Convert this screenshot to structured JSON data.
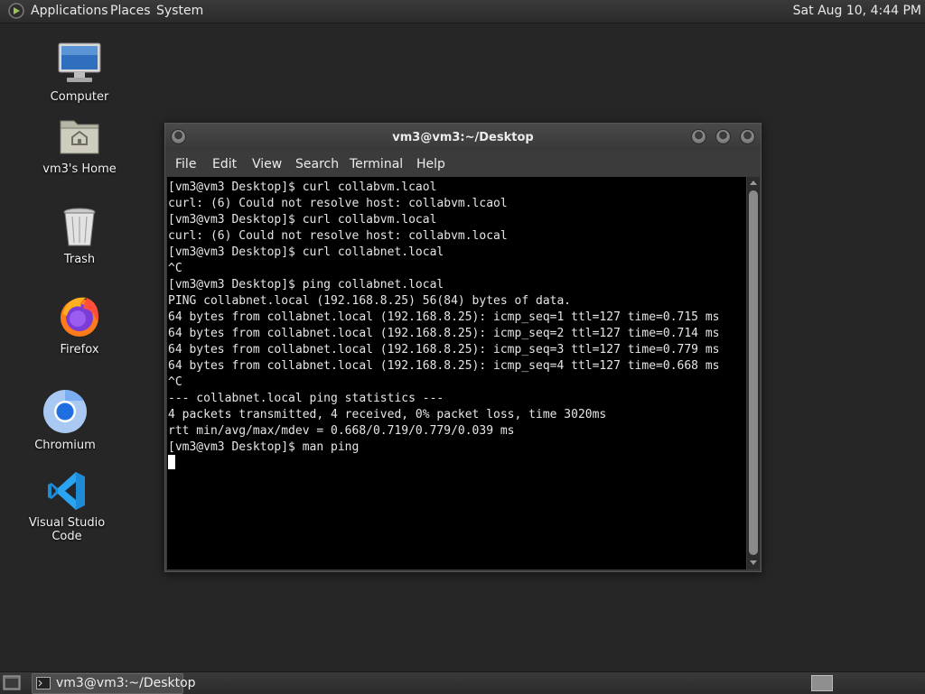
{
  "top_panel": {
    "menus": [
      "Applications",
      "Places",
      "System"
    ],
    "clock": "Sat Aug 10,  4:44 PM"
  },
  "desktop_icons": [
    {
      "label": "Computer",
      "icon": "computer-icon"
    },
    {
      "label": "vm3's Home",
      "icon": "home-folder-icon"
    },
    {
      "label": "Trash",
      "icon": "trash-icon"
    },
    {
      "label": "Firefox",
      "icon": "firefox-icon"
    },
    {
      "label": "Chromium",
      "icon": "chromium-icon"
    },
    {
      "label": "Visual Studio Code",
      "icon": "vscode-icon"
    }
  ],
  "terminal": {
    "title": "vm3@vm3:~/Desktop",
    "menu": [
      "File",
      "Edit",
      "View",
      "Search",
      "Terminal",
      "Help"
    ],
    "lines": [
      "[vm3@vm3 Desktop]$ curl collabvm.lcaol",
      "curl: (6) Could not resolve host: collabvm.lcaol",
      "[vm3@vm3 Desktop]$ curl collabvm.local",
      "curl: (6) Could not resolve host: collabvm.local",
      "[vm3@vm3 Desktop]$ curl collabnet.local",
      "^C",
      "[vm3@vm3 Desktop]$ ping collabnet.local",
      "PING collabnet.local (192.168.8.25) 56(84) bytes of data.",
      "64 bytes from collabnet.local (192.168.8.25): icmp_seq=1 ttl=127 time=0.715 ms",
      "64 bytes from collabnet.local (192.168.8.25): icmp_seq=2 ttl=127 time=0.714 ms",
      "64 bytes from collabnet.local (192.168.8.25): icmp_seq=3 ttl=127 time=0.779 ms",
      "64 bytes from collabnet.local (192.168.8.25): icmp_seq=4 ttl=127 time=0.668 ms",
      "^C",
      "--- collabnet.local ping statistics ---",
      "4 packets transmitted, 4 received, 0% packet loss, time 3020ms",
      "rtt min/avg/max/mdev = 0.668/0.719/0.779/0.039 ms",
      "[vm3@vm3 Desktop]$ man ping"
    ]
  },
  "taskbar": {
    "window_button": "vm3@vm3:~/Desktop"
  },
  "colors": {
    "desktop_bg": "#262626",
    "terminal_bg": "#000000",
    "terminal_fg": "#e6e6e6",
    "panel_bg": "#333333"
  }
}
